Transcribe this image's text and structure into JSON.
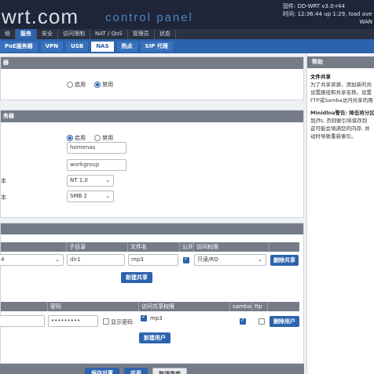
{
  "header": {
    "logo": "wrt.com",
    "subtitle": "control panel",
    "info_lines": [
      "固件: DD-WRT v3.0-r44",
      "时间: 12:36:44 up 1:29, load averag",
      "WAN"
    ]
  },
  "nav_main": [
    "络",
    "服务",
    "安全",
    "访问限制",
    "NAT / QoS",
    "管理员",
    "状态"
  ],
  "nav_sub": [
    "PoE服务器",
    "VPN",
    "USB",
    "NAS",
    "热点",
    "SIP 代理"
  ],
  "panel1": {
    "head": "器",
    "radio_enable": "启用",
    "radio_disable": "禁用"
  },
  "panel2": {
    "head": "务器",
    "radio_enable": "启用",
    "radio_disable": "禁用",
    "hostname": "homenas",
    "workgroup": "workgroup",
    "row_label_1": "本",
    "row_label_2": "本",
    "min_proto": "NT 1.0",
    "max_proto": "SMB 2"
  },
  "panel3": {
    "share_headers": [
      "子目录",
      "文件名",
      "公开",
      "访问权限"
    ],
    "share_row": {
      "path": "4",
      "subdir": "dir1",
      "name": "mp3",
      "access": "只读/RO"
    },
    "delete_share": "删除共享",
    "add_share": "新建共享",
    "user_headers": [
      "密码",
      "访问共享权限",
      "samba",
      "ftp"
    ],
    "password": "•••••••••",
    "show_password": "显示密码",
    "user_share": "mp3",
    "delete_user": "删除用户",
    "add_user": "新建用户"
  },
  "footer_buttons": [
    "保存设置",
    "应用",
    "取消改变"
  ],
  "help": {
    "head": "帮助",
    "s1_title": "文件共享",
    "s1_lines": [
      "为了共享资源，添加新的共",
      "设置路径和共享名称。设置",
      "FTP或Samba访问共享的用"
    ],
    "s2_title": "Minidlna警告",
    "s2_lines": [
      "Minidlna警告: 降低将分区",
      "到jffs, 否则索引将保存到",
      "这可能会填满您的内存, 并",
      "动时导致重新索引。"
    ]
  }
}
